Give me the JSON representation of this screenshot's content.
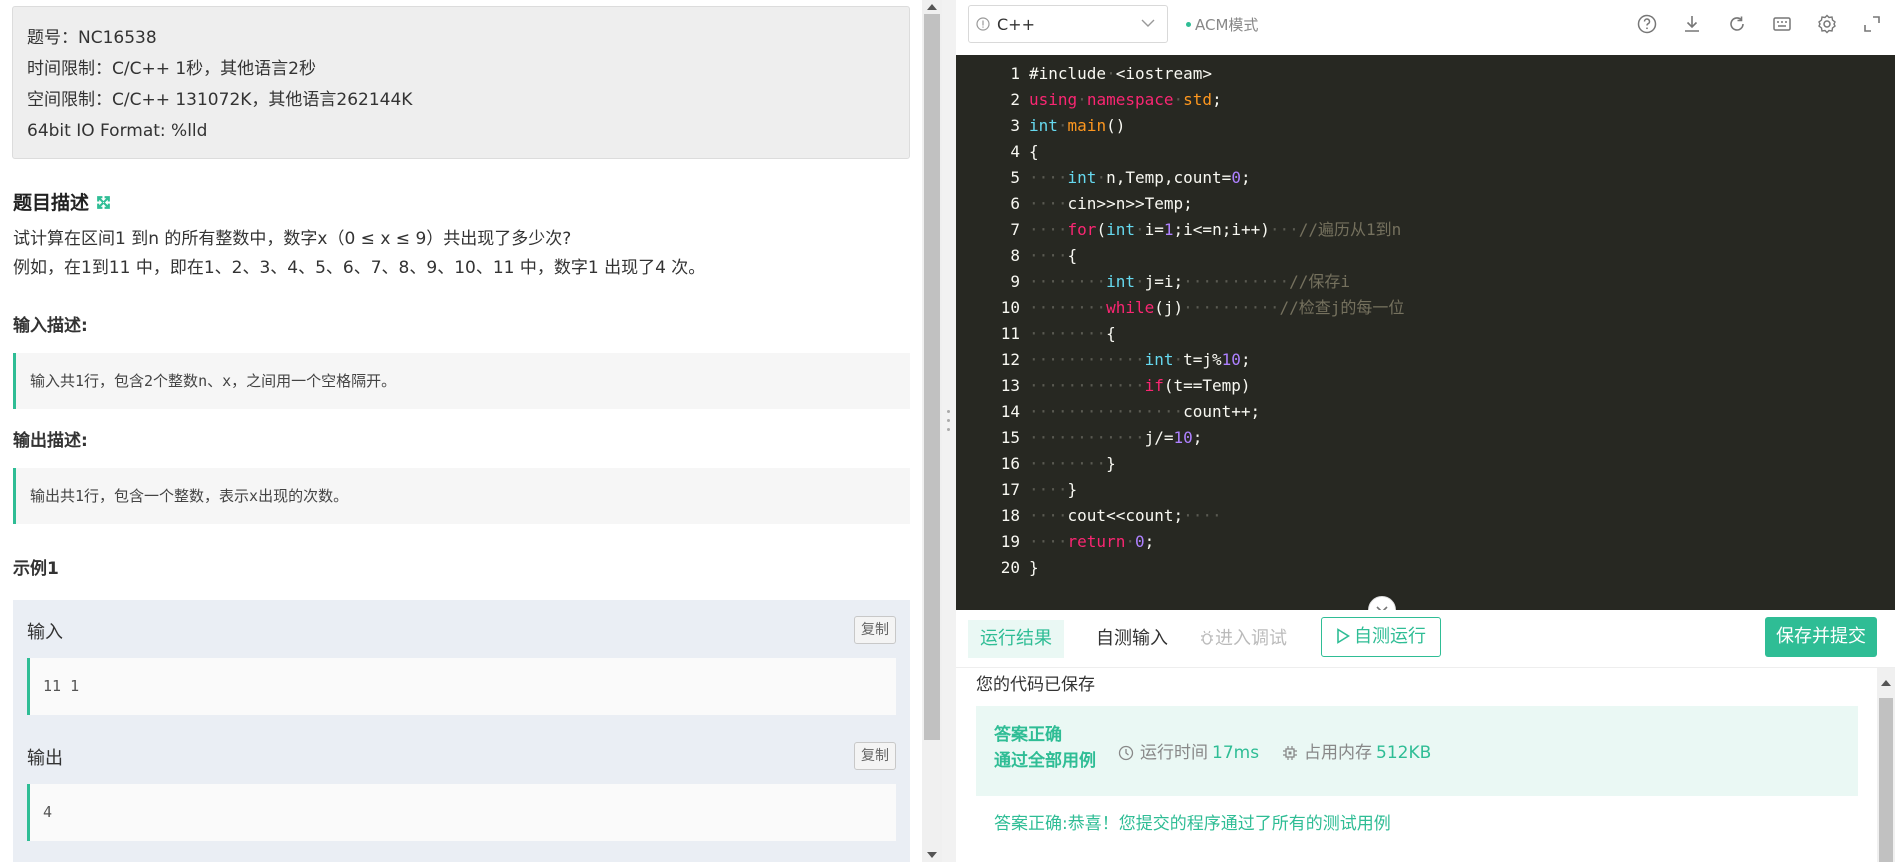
{
  "problem": {
    "info": [
      "题号：NC16538",
      "时间限制：C/C++ 1秒，其他语言2秒",
      "空间限制：C/C++ 131072K，其他语言262144K",
      "64bit IO Format: %lld"
    ],
    "desc_title": "题目描述",
    "desc_lines": [
      "试计算在区间1 到n 的所有整数中，数字x（0 ≤ x ≤ 9）共出现了多少次?",
      "例如，在1到11 中，即在1、2、3、4、5、6、7、8、9、10、11 中，数字1 出现了4 次。"
    ],
    "input_title": "输入描述:",
    "input_text": "输入共1行，包含2个整数n、x，之间用一个空格隔开。",
    "output_title": "输出描述:",
    "output_text": "输出共1行，包含一个整数，表示x出现的次数。",
    "example_title": "示例1",
    "sample_input_label": "输入",
    "sample_input": "11 1",
    "sample_output_label": "输出",
    "sample_output": "4",
    "copy_label": "复制"
  },
  "editor": {
    "language": "C++",
    "mode": "ACM模式",
    "toolbar_icons": [
      "help-icon",
      "download-icon",
      "refresh-icon",
      "keyboard-icon",
      "settings-icon",
      "fullscreen-icon"
    ],
    "line_numbers": [
      "1",
      "2",
      "3",
      "4",
      "5",
      "6",
      "7",
      "8",
      "9",
      "10",
      "11",
      "12",
      "13",
      "14",
      "15",
      "16",
      "17",
      "18",
      "19",
      "20"
    ]
  },
  "bottom": {
    "tab_result": "运行结果",
    "tab_input": "自测输入",
    "tab_debug": "进入调试",
    "run_label": "自测运行",
    "submit_label": "保存并提交"
  },
  "result": {
    "saved": "您的代码已保存",
    "status_line1": "答案正确",
    "status_line2": "通过全部用例",
    "time_label": "运行时间",
    "time_value": "17ms",
    "mem_label": "占用内存",
    "mem_value": "512KB",
    "message": "答案正确:恭喜！您提交的程序通过了所有的测试用例"
  },
  "colors": {
    "accent": "#2fbd95",
    "editor_bg": "#272822"
  }
}
